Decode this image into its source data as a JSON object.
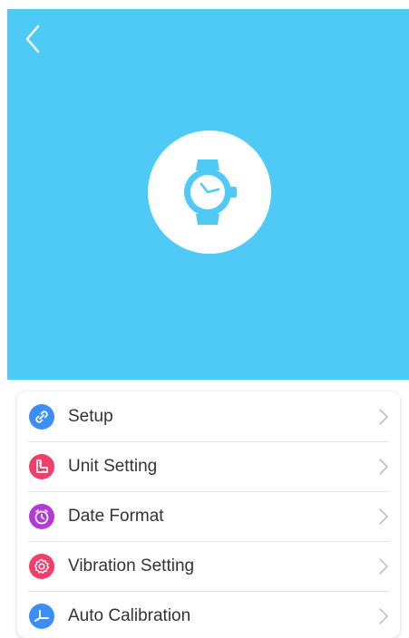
{
  "colors": {
    "hero_background": "#4fcaf6",
    "accent": "#4fcaf6",
    "setup_icon": "#3a8ef6",
    "unit_icon": "#f33d6a",
    "date_icon": "#b13ad8",
    "vibration_icon": "#f33d6a",
    "calibration_icon": "#3a8ef6"
  },
  "header": {
    "back_icon": "chevron-left-icon",
    "device_icon": "watch-icon"
  },
  "menu": {
    "items": [
      {
        "label": "Setup",
        "icon": "link-icon",
        "color": "#3a8ef6"
      },
      {
        "label": "Unit Setting",
        "icon": "ruler-icon",
        "color": "#f33d6a"
      },
      {
        "label": "Date Format",
        "icon": "clock-icon",
        "color": "#b13ad8"
      },
      {
        "label": "Vibration Setting",
        "icon": "gear-icon",
        "color": "#f33d6a"
      },
      {
        "label": "Auto Calibration",
        "icon": "calibration-icon",
        "color": "#3a8ef6"
      }
    ]
  }
}
